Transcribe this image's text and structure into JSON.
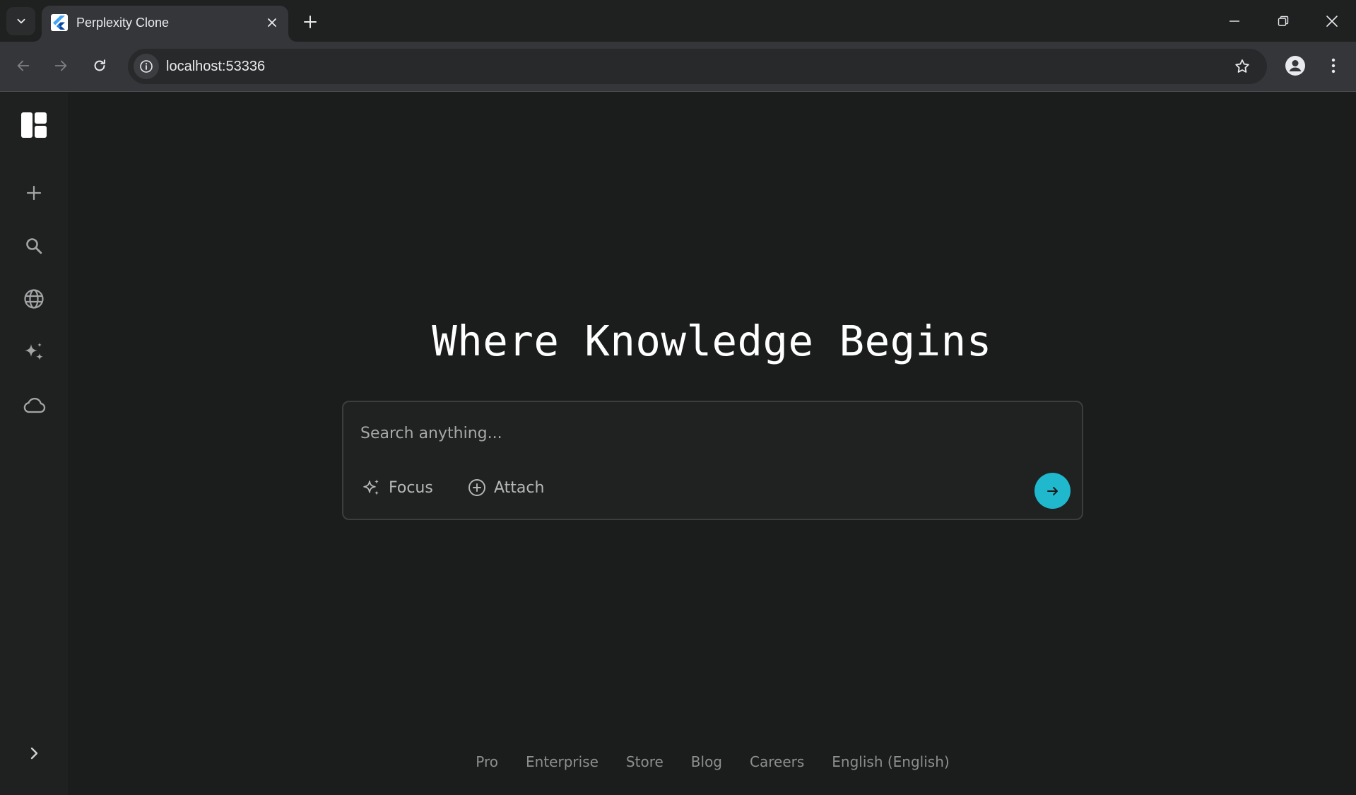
{
  "browser": {
    "tab": {
      "title": "Perplexity Clone"
    },
    "address_bar": {
      "url": "localhost:53336"
    }
  },
  "app": {
    "hero_title": "Where Knowledge Begins",
    "search": {
      "placeholder": "Search anything...",
      "focus_label": "Focus",
      "attach_label": "Attach"
    },
    "footer_links": [
      {
        "label": "Pro"
      },
      {
        "label": "Enterprise"
      },
      {
        "label": "Store"
      },
      {
        "label": "Blog"
      },
      {
        "label": "Careers"
      },
      {
        "label": "English (English)"
      }
    ],
    "sidebar_icons": [
      "logo-icon",
      "plus-icon",
      "search-icon",
      "globe-icon",
      "sparkles-icon",
      "cloud-icon",
      "chevron-right-icon"
    ]
  },
  "colors": {
    "accent": "#1fb8cd",
    "background": "#1b1c1c",
    "sidebar": "#1f2121",
    "text_primary": "#ffffff",
    "text_muted": "#8c8e8f"
  }
}
